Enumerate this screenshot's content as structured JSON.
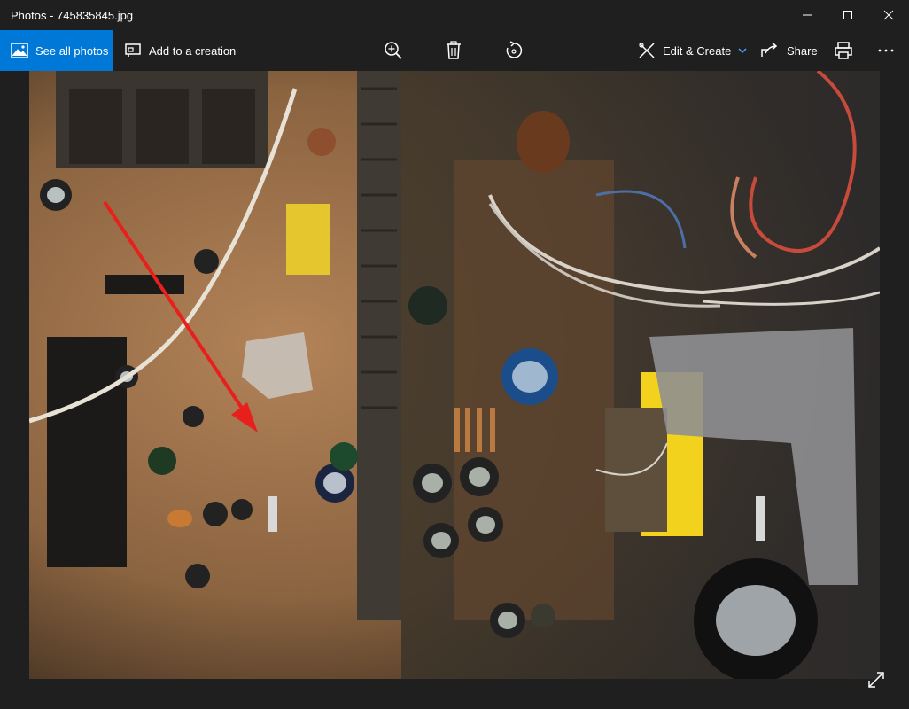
{
  "window": {
    "title": "Photos - 745835845.jpg"
  },
  "toolbar": {
    "see_all": "See all photos",
    "add_creation": "Add to a creation",
    "edit_create": "Edit & Create",
    "share": "Share"
  },
  "colors": {
    "accent": "#0078d7",
    "background": "#1f1f1f",
    "arrow": "#e8201d"
  },
  "icons": [
    "photos-icon",
    "add-creation-icon",
    "zoom-icon",
    "delete-icon",
    "rotate-icon",
    "edit-create-icon",
    "chevron-down-icon",
    "share-icon",
    "print-icon",
    "more-icon",
    "minimize-icon",
    "maximize-icon",
    "close-icon",
    "fullscreen-icon"
  ]
}
